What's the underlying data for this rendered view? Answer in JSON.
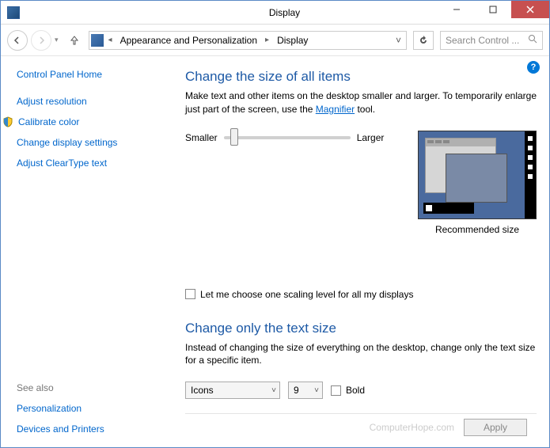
{
  "titlebar": {
    "title": "Display"
  },
  "breadcrumb": {
    "level1": "Appearance and Personalization",
    "level2": "Display"
  },
  "search": {
    "placeholder": "Search Control ..."
  },
  "sidebar": {
    "home": "Control Panel Home",
    "items": [
      {
        "label": "Adjust resolution"
      },
      {
        "label": "Calibrate color"
      },
      {
        "label": "Change display settings"
      },
      {
        "label": "Adjust ClearType text"
      }
    ],
    "see_also_label": "See also",
    "see_also": [
      {
        "label": "Personalization"
      },
      {
        "label": "Devices and Printers"
      }
    ]
  },
  "content": {
    "heading1": "Change the size of all items",
    "desc1_a": "Make text and other items on the desktop smaller and larger. To temporarily enlarge just part of the screen, use the ",
    "desc1_link": "Magnifier",
    "desc1_b": " tool.",
    "slider": {
      "min_label": "Smaller",
      "max_label": "Larger"
    },
    "preview_caption": "Recommended size",
    "checkbox_label": "Let me choose one scaling level for all my displays",
    "heading2": "Change only the text size",
    "desc2": "Instead of changing the size of everything on the desktop, change only the text size for a specific item.",
    "item_select": {
      "value": "Icons"
    },
    "size_select": {
      "value": "9"
    },
    "bold_label": "Bold"
  },
  "footer": {
    "watermark": "ComputerHope.com",
    "apply": "Apply"
  }
}
